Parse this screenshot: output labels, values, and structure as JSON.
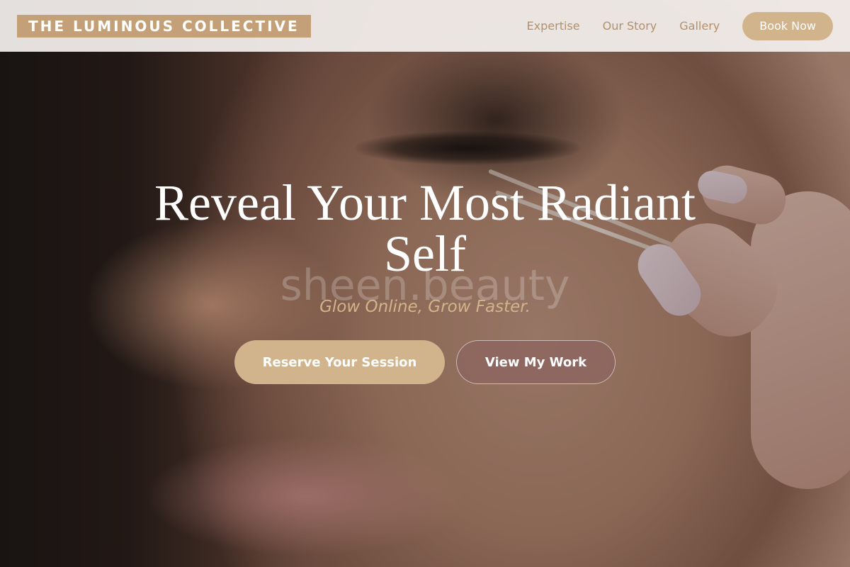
{
  "header": {
    "logo_text": "THE LUMINOUS COLLECTIVE",
    "nav": [
      {
        "label": "Expertise"
      },
      {
        "label": "Our Story"
      },
      {
        "label": "Gallery"
      }
    ],
    "book_button": "Book Now"
  },
  "hero": {
    "title": "Reveal Your Most Radiant Self",
    "watermark": "sheen.beauty",
    "tagline": "Glow Online, Grow Faster.",
    "primary_cta": "Reserve Your Session",
    "secondary_cta": "View My Work"
  },
  "colors": {
    "accent": "#d2b48c",
    "logo_bg": "#c4a079",
    "nav_text": "#b49069",
    "header_bg": "#f4f0ee"
  }
}
